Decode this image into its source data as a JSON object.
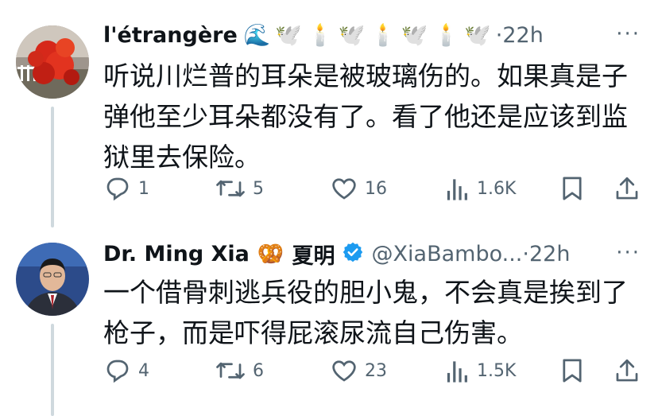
{
  "tweets": [
    {
      "author_name": "l'étrangère",
      "name_emojis": [
        "🌊",
        "🕊️",
        "🕯️",
        "🕊️",
        "🕯️",
        "🕊️",
        "🕯️",
        "🕊️"
      ],
      "separator": "·",
      "time": "22h",
      "more": "···",
      "text": "听说川烂普的耳朵是被玻璃伤的。如果真是子弹他至少耳朵都没有了。看了他还是应该到监狱里去保险。",
      "replies": "1",
      "retweets": "5",
      "likes": "16",
      "views": "1.6K"
    },
    {
      "author_name": "Dr. Ming Xia",
      "name_emoji": "🥨",
      "author_name_zh": "夏明",
      "handle": "@XiaBambo...",
      "separator": "·",
      "time": "22h",
      "more": "···",
      "text": "一个借骨刺逃兵役的胆小鬼，不会真是挨到了枪子，而是吓得屁滚尿流自己伤害。",
      "replies": "4",
      "retweets": "6",
      "likes": "23",
      "views": "1.5K"
    }
  ],
  "colors": {
    "text": "#0f1419",
    "secondary": "#536471",
    "verified": "#1d9bf0",
    "thread_line": "#cfd9de"
  }
}
